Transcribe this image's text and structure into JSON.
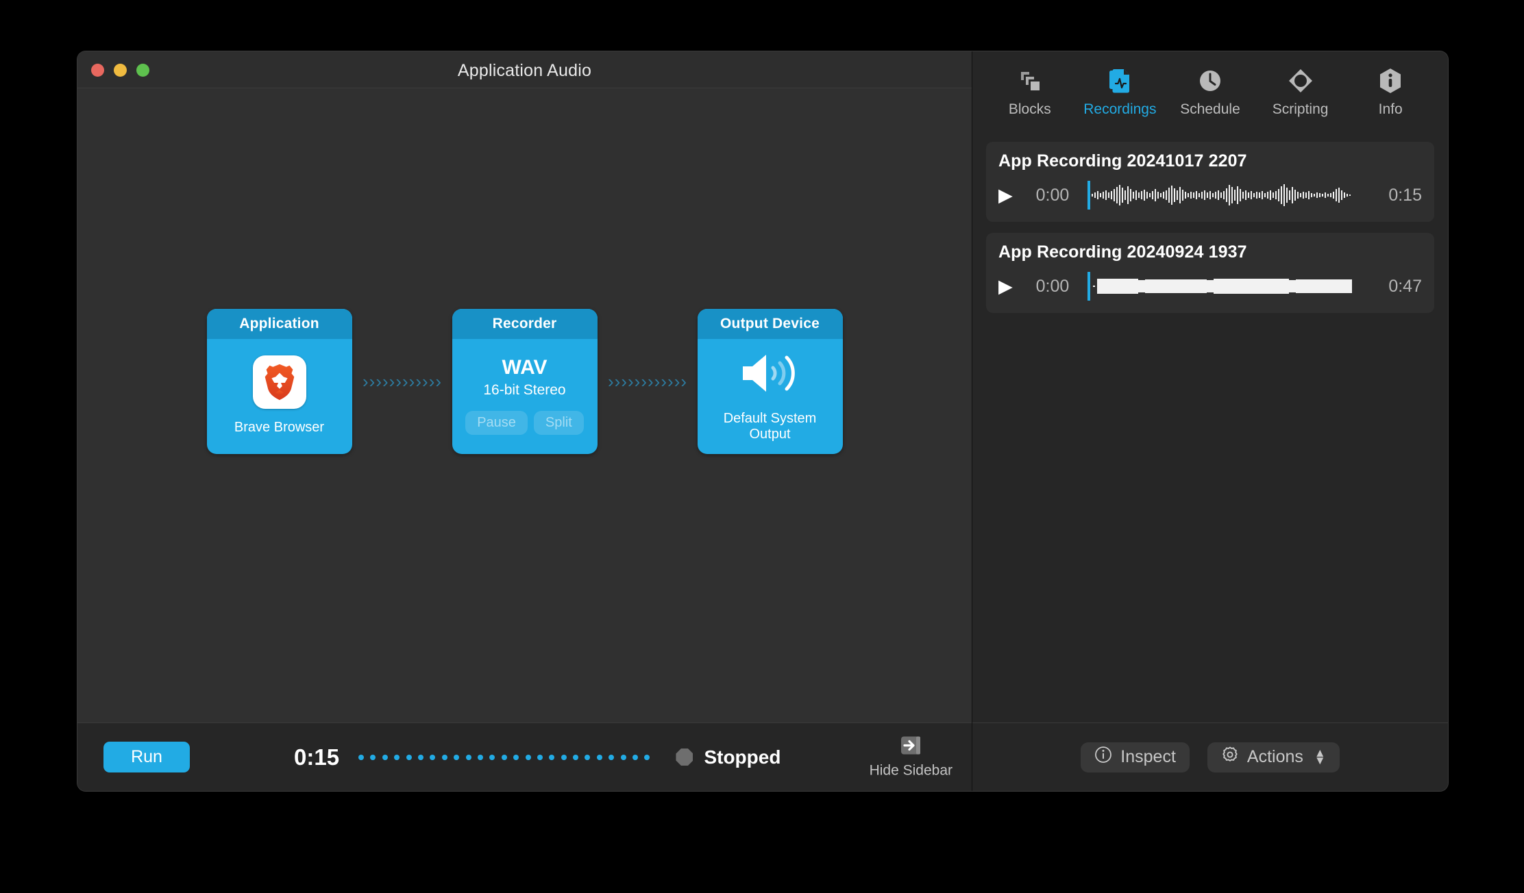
{
  "window": {
    "title": "Application Audio",
    "traffic_lights": [
      "close-red",
      "minimize-yellow",
      "zoom-green"
    ]
  },
  "canvas": {
    "blocks": [
      {
        "header": "Application",
        "icon": "brave-browser-icon",
        "caption": "Brave Browser"
      },
      {
        "header": "Recorder",
        "format": "WAV",
        "format_detail": "16-bit Stereo",
        "buttons": [
          {
            "label": "Pause",
            "enabled": false
          },
          {
            "label": "Split",
            "enabled": false
          }
        ]
      },
      {
        "header": "Output Device",
        "icon": "speaker-icon",
        "caption": "Default System Output"
      }
    ],
    "connector_glyph": "›",
    "connector_count": 12
  },
  "bottom_bar": {
    "run_label": "Run",
    "elapsed": "0:15",
    "progress_dot_count": 25,
    "status_label": "Stopped",
    "status_color": "#6e6e6e",
    "hide_sidebar_label": "Hide Sidebar",
    "hide_sidebar_icon": "arrow-right-to-panel-icon"
  },
  "sidebar": {
    "tabs": [
      {
        "label": "Blocks",
        "icon": "blocks-icon",
        "active": false
      },
      {
        "label": "Recordings",
        "icon": "recordings-document-icon",
        "active": true
      },
      {
        "label": "Schedule",
        "icon": "clock-icon",
        "active": false
      },
      {
        "label": "Scripting",
        "icon": "scripting-diamond-icon",
        "active": false
      },
      {
        "label": "Info",
        "icon": "info-hexagon-icon",
        "active": false
      }
    ],
    "recordings": [
      {
        "title": "App Recording 20241017 2207",
        "position": "0:00",
        "duration": "0:15",
        "play_icon": "play-icon"
      },
      {
        "title": "App Recording 20240924 1937",
        "position": "0:00",
        "duration": "0:47",
        "play_icon": "play-icon"
      }
    ],
    "footer": {
      "inspect_label": "Inspect",
      "inspect_icon": "info-circle-icon",
      "actions_label": "Actions",
      "actions_icon": "gear-icon",
      "actions_chevron": "chevron-up-down-icon"
    }
  },
  "colors": {
    "accent": "#22abe4",
    "block_header": "#1891c6",
    "window_bg": "#2b2b2b",
    "canvas_bg": "#303030",
    "sidebar_bg": "#262626"
  }
}
